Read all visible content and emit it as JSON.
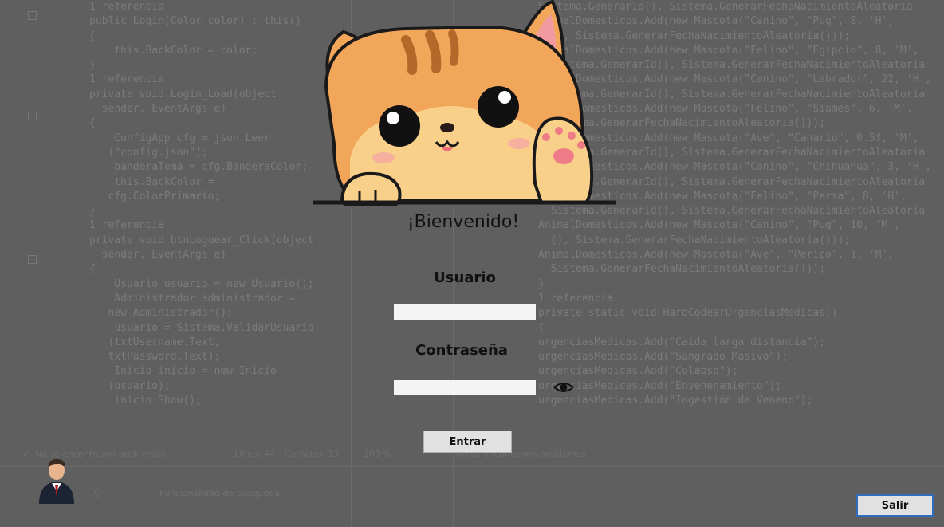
{
  "background_code": {
    "left_lines": [
      "1 referencia",
      "public Login(Color color) : this()",
      "{",
      "    this.BackColor = color;",
      "}",
      "",
      "1 referencia",
      "private void Login_Load(object",
      "  sender, EventArgs e)",
      "{",
      "    ConfigApp cfg = json.Leer",
      "   (\"config.json\");",
      "    banderaTema = cfg.BanderaColor;",
      "    this.BackColor =",
      "   cfg.ColorPrimario;",
      "}",
      "1 referencia",
      "private void btnLoguear_Click(object",
      "  sender, EventArgs e)",
      "{",
      "    Usuario usuario = new Usuario();",
      "    Administrador administrador =",
      "   new Administrador();",
      "",
      "    usuario = Sistema.ValidarUsuario",
      "   (txtUsername.Text,",
      "   txtPassword.Text);",
      "",
      "    Inicio inicio = new Inicio",
      "   (usuario);",
      "    inicio.Show();"
    ],
    "right_lines": [
      "Sistema.GenerarId(), Sistema.GenerarFechaNacimientoAleatoria",
      "AnimalDomesticos.Add(new Mascota(\"Canino\", \"Pug\", 8, 'H',",
      "  (), Sistema.GenerarFechaNacimientoAleatoria()));",
      "AnimalDomesticos.Add(new Mascota(\"Felino\", \"Egipcio\", 8, 'M',",
      "  Sistema.GenerarId(), Sistema.GenerarFechaNacimientoAleatoria",
      "AnimalDomesticos.Add(new Mascota(\"Canino\", \"Labrador\", 22, 'H',",
      "  Sistema.GenerarId(), Sistema.GenerarFechaNacimientoAleatoria",
      "AnimalDomesticos.Add(new Mascota(\"Felino\", \"Siames\", 6, 'M',",
      "  Sistema.GenerarFechaNacimientoAleatoria()));",
      "AnimalDomesticos.Add(new Mascota(\"Ave\", \"Canario\", 0.5f, 'M',",
      "  Sistema.GenerarId(), Sistema.GenerarFechaNacimientoAleatoria",
      "AnimalDomesticos.Add(new Mascota(\"Canino\", \"Chihuahua\", 3, 'H',",
      "  Sistema.GenerarId(), Sistema.GenerarFechaNacimientoAleatoria",
      "AnimalDomesticos.Add(new Mascota(\"Felino\", \"Persa\", 8, 'H',",
      "  Sistema.GenerarId(), Sistema.GenerarFechaNacimientoAleatoria",
      "AnimalDomesticos.Add(new Mascota(\"Canino\", \"Pug\", 10, 'M',",
      "  (), Sistema.GenerarFechaNacimientoAleatoria()));",
      "AnimalDomesticos.Add(new Mascota(\"Ave\", \"Perico\", 1, 'M',",
      "  Sistema.GenerarFechaNacimientoAleatoria()));",
      "",
      "",
      "",
      "}",
      "1 referencia",
      "private static void HardCodearUrgenciasMedicas()",
      "{",
      "urgenciasMedicas.Add(\"Caida larga distancia\");",
      "urgenciasMedicas.Add(\"Sangrado Masivo\");",
      "urgenciasMedicas.Add(\"Colapso\");",
      "urgenciasMedicas.Add(\"Envenenamiento\");",
      "urgenciasMedicas.Add(\"Ingestión de Veneno\");"
    ],
    "status_left": "No se encontraron problemas",
    "status_line": "Línea: 44",
    "status_col": "Carácter: 13",
    "status_zoom": "109 %",
    "status_right": "No se encontraron problemas",
    "search_placeholder": "Funcionalidad de búsqueda"
  },
  "login": {
    "welcome": "¡Bienvenido!",
    "user_label": "Usuario",
    "user_value": "",
    "password_label": "Contraseña",
    "password_value": "",
    "show_password_icon": "eye-icon",
    "enter_button": "Entrar",
    "mascot_icon": "cat-mascot"
  },
  "footer": {
    "avatar_icon": "businessman-avatar",
    "exit_button": "Salir"
  },
  "colors": {
    "overlay": "#5f5f5f",
    "cat_orange": "#f2a65a",
    "button_border": "#2f6cc0"
  }
}
